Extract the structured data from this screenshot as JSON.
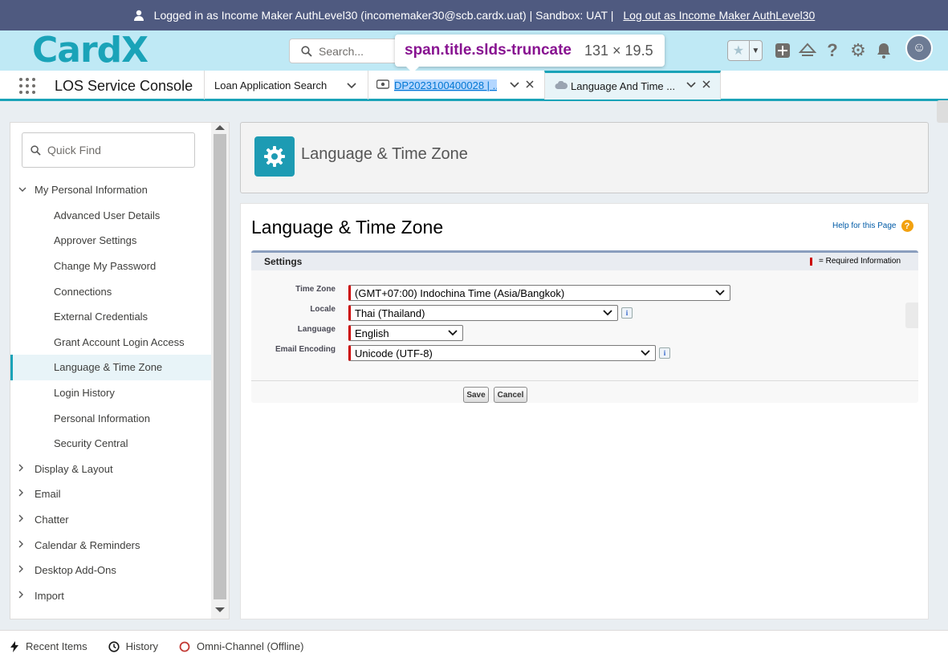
{
  "banner": {
    "text": "Logged in as Income Maker AuthLevel30 (incomemaker30@scb.cardx.uat) | Sandbox: UAT |",
    "logout": "Log out as Income Maker AuthLevel30"
  },
  "header": {
    "logo": "CardX",
    "search_placeholder": "Search...",
    "tooltip_selector": "span.title.slds-truncate",
    "tooltip_dims": "131 × 19.5"
  },
  "console": {
    "app_name": "LOS Service Console",
    "tabs": [
      {
        "label": "Loan Application Search"
      },
      {
        "label": "DP2023100400028 | ..."
      },
      {
        "label": "Language And Time ..."
      }
    ]
  },
  "sidebar": {
    "quick_find_placeholder": "Quick Find",
    "items": [
      {
        "label": "My Personal Information",
        "level": 0,
        "expanded": true
      },
      {
        "label": "Advanced User Details",
        "level": 1
      },
      {
        "label": "Approver Settings",
        "level": 1
      },
      {
        "label": "Change My Password",
        "level": 1
      },
      {
        "label": "Connections",
        "level": 1
      },
      {
        "label": "External Credentials",
        "level": 1
      },
      {
        "label": "Grant Account Login Access",
        "level": 1
      },
      {
        "label": "Language & Time Zone",
        "level": 1,
        "active": true
      },
      {
        "label": "Login History",
        "level": 1
      },
      {
        "label": "Personal Information",
        "level": 1
      },
      {
        "label": "Security Central",
        "level": 1
      },
      {
        "label": "Display & Layout",
        "level": 0
      },
      {
        "label": "Email",
        "level": 0
      },
      {
        "label": "Chatter",
        "level": 0
      },
      {
        "label": "Calendar & Reminders",
        "level": 0
      },
      {
        "label": "Desktop Add-Ons",
        "level": 0
      },
      {
        "label": "Import",
        "level": 0
      }
    ]
  },
  "main": {
    "title_box": "Language & Time Zone",
    "page_heading": "Language & Time Zone",
    "help_link": "Help for this Page",
    "settings_title": "Settings",
    "required_legend": "= Required Information",
    "fields": {
      "time_zone": {
        "label": "Time Zone",
        "value": "(GMT+07:00) Indochina Time (Asia/Bangkok)"
      },
      "locale": {
        "label": "Locale",
        "value": "Thai (Thailand)"
      },
      "language": {
        "label": "Language",
        "value": "English"
      },
      "email_encoding": {
        "label": "Email Encoding",
        "value": "Unicode (UTF-8)"
      }
    },
    "save": "Save",
    "cancel": "Cancel"
  },
  "utility": {
    "recent": "Recent Items",
    "history": "History",
    "omni": "Omni-Channel (Offline)"
  },
  "colors": {
    "accent": "#1aa3b8",
    "banner": "#4f5a80",
    "header": "#bfe9f5",
    "required": "#cc0000"
  }
}
